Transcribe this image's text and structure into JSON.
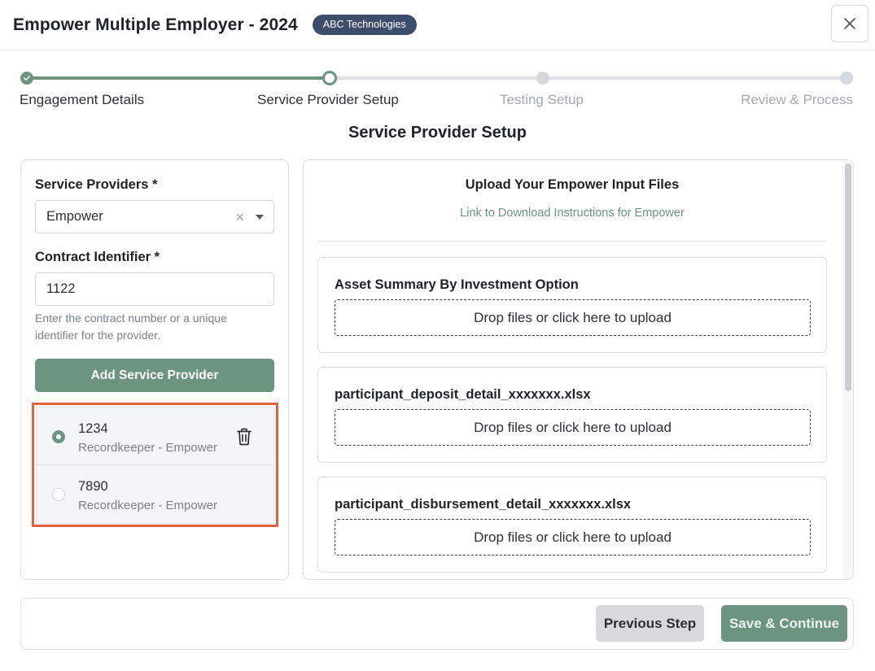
{
  "header": {
    "title": "Empower Multiple Employer - 2024",
    "badge": "ABC Technologies"
  },
  "stepper": {
    "steps": [
      {
        "label": "Engagement Details",
        "state": "complete"
      },
      {
        "label": "Service Provider Setup",
        "state": "current"
      },
      {
        "label": "Testing Setup",
        "state": "pending"
      },
      {
        "label": "Review & Process",
        "state": "pending"
      }
    ]
  },
  "section_title": "Service Provider Setup",
  "left": {
    "service_providers_label": "Service Providers *",
    "service_provider_value": "Empower",
    "clear_glyph": "×",
    "contract_label": "Contract Identifier *",
    "contract_value": "1122",
    "helper_text": "Enter the contract number or a unique identifier for the provider.",
    "add_button": "Add Service Provider",
    "providers": [
      {
        "id": "1234",
        "role": "Recordkeeper - Empower",
        "selected": true
      },
      {
        "id": "7890",
        "role": "Recordkeeper - Empower",
        "selected": false
      }
    ]
  },
  "right": {
    "upload_title": "Upload Your Empower Input Files",
    "download_link": "Link to Download Instructions for Empower",
    "files": [
      {
        "name": "Asset Summary By Investment Option",
        "dropzone": "Drop files or click here to upload"
      },
      {
        "name": "participant_deposit_detail_xxxxxxx.xlsx",
        "dropzone": "Drop files or click here to upload"
      },
      {
        "name": "participant_disbursement_detail_xxxxxxx.xlsx",
        "dropzone": "Drop files or click here to upload"
      }
    ]
  },
  "footer": {
    "previous": "Previous Step",
    "save": "Save & Continue"
  },
  "colors": {
    "accent": "#6b9580",
    "badge": "#3e4d6c",
    "highlight": "#e0613f"
  }
}
